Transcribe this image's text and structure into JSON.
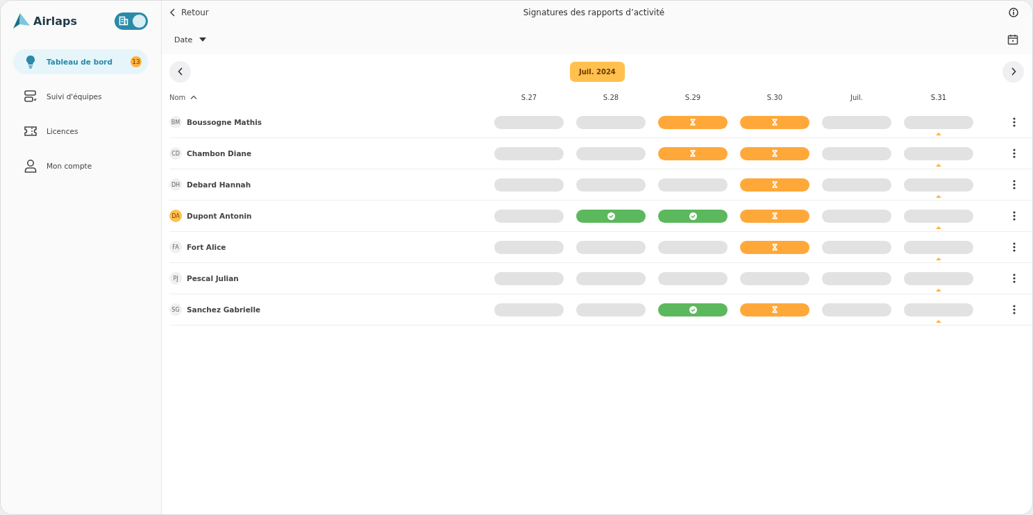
{
  "brand": {
    "name": "Airlaps"
  },
  "mode_toggle": {
    "on": true
  },
  "sidebar": {
    "items": [
      {
        "label": "Tableau de bord",
        "selected": true,
        "badge": "13"
      },
      {
        "label": "Suivi d'équipes",
        "selected": false
      },
      {
        "label": "Licences",
        "selected": false
      },
      {
        "label": "Mon compte",
        "selected": false
      }
    ]
  },
  "header": {
    "back": "Retour",
    "title": "Signatures des rapports d’activité"
  },
  "filter": {
    "label": "Date"
  },
  "period": {
    "label": "Juil. 2024"
  },
  "table": {
    "name_column": "Nom",
    "columns": [
      {
        "label": "S.27",
        "current": false
      },
      {
        "label": "S.28",
        "current": false
      },
      {
        "label": "S.29",
        "current": false
      },
      {
        "label": "S.30",
        "current": false
      },
      {
        "label": "Juil.",
        "current": false
      },
      {
        "label": "S.31",
        "current": true
      }
    ],
    "rows": [
      {
        "initials": "BM",
        "name": "Boussogne Mathis",
        "highlighted": false,
        "cells": [
          {
            "kind": "empty"
          },
          {
            "kind": "empty"
          },
          {
            "kind": "pending"
          },
          {
            "kind": "pending"
          },
          {
            "kind": "empty"
          },
          {
            "kind": "empty"
          }
        ]
      },
      {
        "initials": "CD",
        "name": "Chambon Diane",
        "highlighted": false,
        "cells": [
          {
            "kind": "empty"
          },
          {
            "kind": "empty"
          },
          {
            "kind": "pending"
          },
          {
            "kind": "pending"
          },
          {
            "kind": "empty"
          },
          {
            "kind": "empty"
          }
        ]
      },
      {
        "initials": "DH",
        "name": "Debard Hannah",
        "highlighted": false,
        "cells": [
          {
            "kind": "empty"
          },
          {
            "kind": "empty"
          },
          {
            "kind": "empty"
          },
          {
            "kind": "pending"
          },
          {
            "kind": "empty"
          },
          {
            "kind": "empty"
          }
        ]
      },
      {
        "initials": "DA",
        "name": "Dupont Antonin",
        "highlighted": true,
        "cells": [
          {
            "kind": "empty"
          },
          {
            "kind": "signed"
          },
          {
            "kind": "signed"
          },
          {
            "kind": "pending"
          },
          {
            "kind": "empty"
          },
          {
            "kind": "empty"
          }
        ]
      },
      {
        "initials": "FA",
        "name": "Fort Alice",
        "highlighted": false,
        "cells": [
          {
            "kind": "empty"
          },
          {
            "kind": "empty"
          },
          {
            "kind": "empty"
          },
          {
            "kind": "pending"
          },
          {
            "kind": "empty"
          },
          {
            "kind": "empty"
          }
        ]
      },
      {
        "initials": "PJ",
        "name": "Pescal Julian",
        "highlighted": false,
        "cells": [
          {
            "kind": "empty"
          },
          {
            "kind": "empty"
          },
          {
            "kind": "empty"
          },
          {
            "kind": "empty"
          },
          {
            "kind": "empty"
          },
          {
            "kind": "empty"
          }
        ]
      },
      {
        "initials": "SG",
        "name": "Sanchez Gabrielle",
        "highlighted": false,
        "cells": [
          {
            "kind": "empty"
          },
          {
            "kind": "empty"
          },
          {
            "kind": "signed"
          },
          {
            "kind": "pending"
          },
          {
            "kind": "empty"
          },
          {
            "kind": "empty"
          }
        ]
      }
    ]
  }
}
